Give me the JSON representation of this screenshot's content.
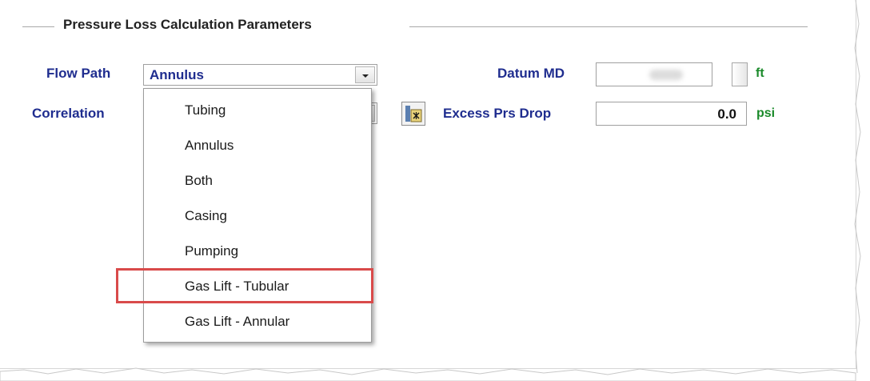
{
  "group": {
    "title": "Pressure Loss Calculation Parameters"
  },
  "flow_path": {
    "label": "Flow Path",
    "value": "Annulus"
  },
  "correlation": {
    "label": "Correlation"
  },
  "datum_md": {
    "label": "Datum MD",
    "unit": "ft"
  },
  "excess_prs_drop": {
    "label": "Excess Prs Drop",
    "value": "0.0",
    "unit": "psi"
  },
  "dropdown": {
    "options": [
      "Tubing",
      "Annulus",
      "Both",
      "Casing",
      "Pumping",
      "Gas Lift - Tubular",
      "Gas Lift - Annular"
    ]
  },
  "icons": {
    "combo_arrow": "chevron-down-icon",
    "calculator": "calculator-icon"
  },
  "colors": {
    "label": "#1f2d8f",
    "unit": "#1a8a2a",
    "highlight": "#d94a4a"
  }
}
